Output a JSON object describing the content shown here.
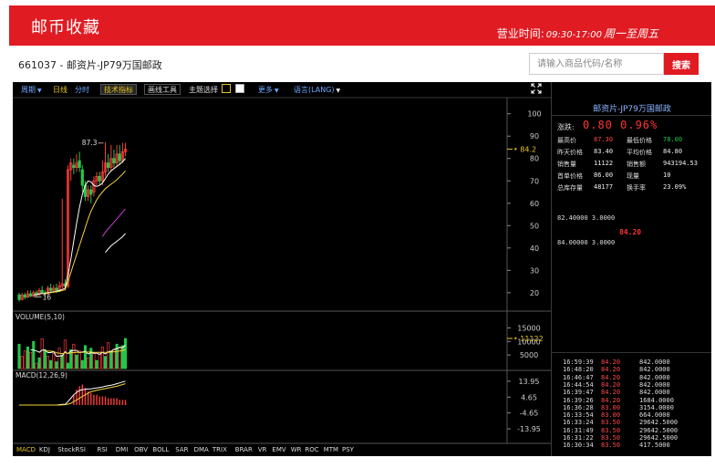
{
  "header": {
    "brand": "邮币收藏",
    "hours_label": "营业时间:",
    "hours_range": "09:30-17:00",
    "hours_days": "周一至周五"
  },
  "product": {
    "title": "661037 - 邮资片-JP79万国邮政"
  },
  "search": {
    "placeholder": "请输入商品代码/名称",
    "button": "搜索"
  },
  "toolbar": {
    "period": "周期",
    "daily": "日线",
    "minute": "分时",
    "tech": "技术指标",
    "draw": "画线工具",
    "theme": "主题选择",
    "more": "更多",
    "language": "语言(LANG)"
  },
  "colors": {
    "header_red": "#e01b22",
    "candle_up": "#ff3b3b",
    "candle_down": "#21c94b",
    "ma_white": "#ffffff",
    "ma_yellow": "#f2d33a",
    "ma_magenta": "#c93bd9",
    "price_label": "#e6c31f"
  },
  "icons": {
    "fullscreen": "fullscreen-icon",
    "dropdown": "chevron-down-icon",
    "checkbox": "theme-checkbox"
  },
  "chart_data": [
    {
      "type": "candlestick",
      "ytick_labels": [
        "100",
        "90",
        "80",
        "70",
        "60",
        "50",
        "40",
        "30",
        "20"
      ],
      "yticks": [
        100,
        90,
        80,
        70,
        60,
        50,
        40,
        30,
        20
      ],
      "ylim": [
        13,
        106
      ],
      "last_price": 84.2,
      "last_price_label": "84.2",
      "high_marker": 87.3,
      "high_label": "87.3",
      "low_marker": 16,
      "low_label": "16",
      "candles": [
        {
          "o": 19,
          "c": 17,
          "h": 20,
          "l": 16
        },
        {
          "o": 17,
          "c": 19,
          "h": 20,
          "l": 16.5
        },
        {
          "o": 19,
          "c": 18,
          "h": 20,
          "l": 17
        },
        {
          "o": 18,
          "c": 19.5,
          "h": 21,
          "l": 17.5
        },
        {
          "o": 19.5,
          "c": 18.5,
          "h": 21,
          "l": 18
        },
        {
          "o": 18.5,
          "c": 20,
          "h": 21,
          "l": 18
        },
        {
          "o": 20,
          "c": 19,
          "h": 21,
          "l": 18
        },
        {
          "o": 19,
          "c": 21,
          "h": 22,
          "l": 18.5
        },
        {
          "o": 21,
          "c": 20,
          "h": 23,
          "l": 19.5
        },
        {
          "o": 20,
          "c": 19.5,
          "h": 21,
          "l": 18
        },
        {
          "o": 19.5,
          "c": 22,
          "h": 23,
          "l": 19
        },
        {
          "o": 22,
          "c": 21,
          "h": 24,
          "l": 20
        },
        {
          "o": 21,
          "c": 22,
          "h": 23.5,
          "l": 20
        },
        {
          "o": 22,
          "c": 21,
          "h": 24,
          "l": 20
        },
        {
          "o": 21,
          "c": 23,
          "h": 25,
          "l": 20.5
        },
        {
          "o": 23,
          "c": 24,
          "h": 62,
          "l": 22
        },
        {
          "o": 24,
          "c": 23,
          "h": 26,
          "l": 22
        },
        {
          "o": 23,
          "c": 75,
          "h": 77,
          "l": 22
        },
        {
          "o": 75,
          "c": 78,
          "h": 80,
          "l": 70
        },
        {
          "o": 77,
          "c": 76,
          "h": 80,
          "l": 73
        },
        {
          "o": 76,
          "c": 78,
          "h": 82,
          "l": 74
        },
        {
          "o": 79,
          "c": 76,
          "h": 83,
          "l": 74
        },
        {
          "o": 75,
          "c": 68,
          "h": 77,
          "l": 65
        },
        {
          "o": 68,
          "c": 63,
          "h": 70,
          "l": 61
        },
        {
          "o": 63,
          "c": 66,
          "h": 68,
          "l": 61
        },
        {
          "o": 66,
          "c": 64,
          "h": 68,
          "l": 60
        },
        {
          "o": 65,
          "c": 70,
          "h": 72,
          "l": 63
        },
        {
          "o": 70,
          "c": 72,
          "h": 74,
          "l": 68
        },
        {
          "o": 72,
          "c": 70,
          "h": 74,
          "l": 68
        },
        {
          "o": 70,
          "c": 74,
          "h": 79,
          "l": 68
        },
        {
          "o": 74,
          "c": 78,
          "h": 87.3,
          "l": 72
        },
        {
          "o": 78,
          "c": 76,
          "h": 82,
          "l": 74
        },
        {
          "o": 76,
          "c": 80,
          "h": 86,
          "l": 74
        },
        {
          "o": 80,
          "c": 78,
          "h": 84,
          "l": 76
        },
        {
          "o": 78,
          "c": 82,
          "h": 86,
          "l": 76
        },
        {
          "o": 82,
          "c": 79,
          "h": 86,
          "l": 77
        },
        {
          "o": 79,
          "c": 83,
          "h": 87,
          "l": 78
        },
        {
          "o": 83,
          "c": 84.2,
          "h": 87,
          "l": 81
        }
      ],
      "ma_white": [
        null,
        null,
        null,
        null,
        null,
        19,
        19,
        19.5,
        19.6,
        19.7,
        20,
        20.2,
        20.4,
        20.6,
        21,
        21.5,
        22,
        28,
        35,
        43,
        51,
        58,
        64,
        68,
        70,
        69.5,
        68,
        67.5,
        68,
        69,
        71,
        73,
        74.5,
        75.5,
        76.5,
        77.5,
        78.5,
        80
      ],
      "ma_yellow": [
        null,
        null,
        null,
        null,
        null,
        null,
        null,
        null,
        null,
        19.5,
        19.8,
        20,
        20.2,
        20.4,
        20.6,
        21,
        21.3,
        25,
        29,
        33,
        37,
        41,
        45,
        49,
        53,
        56.5,
        59,
        61.5,
        63.5,
        65,
        66.5,
        67.5,
        68.5,
        69.5,
        70.5,
        71.8,
        73,
        74.5
      ],
      "ma_magenta": [
        null,
        null,
        null,
        null,
        null,
        null,
        null,
        null,
        null,
        null,
        null,
        null,
        null,
        null,
        null,
        null,
        null,
        null,
        null,
        null,
        null,
        null,
        null,
        null,
        null,
        null,
        null,
        null,
        null,
        45,
        47,
        48.5,
        50,
        51.5,
        53,
        54.5,
        56,
        57.5
      ],
      "ma_white2": [
        null,
        null,
        null,
        null,
        null,
        null,
        null,
        null,
        null,
        null,
        null,
        null,
        null,
        null,
        null,
        null,
        null,
        null,
        null,
        null,
        null,
        null,
        null,
        null,
        null,
        null,
        null,
        null,
        null,
        null,
        38,
        39.5,
        41,
        42,
        43,
        44,
        45,
        46.5
      ]
    },
    {
      "type": "bar",
      "title": "VOLUME(5,10)",
      "ytick_labels": [
        "15000",
        "10000",
        "5000"
      ],
      "yticks": [
        15000,
        10000,
        5000
      ],
      "ylim": [
        0,
        17500
      ],
      "last_volume": 11122,
      "last_volume_label": "11122",
      "values": [
        9000,
        4500,
        6500,
        8000,
        6000,
        10000,
        2000,
        4000,
        11000,
        7000,
        4500,
        3000,
        5500,
        2500,
        7500,
        5000,
        10500,
        2000,
        7000,
        9000,
        5000,
        6500,
        3000,
        8500,
        4000,
        7500,
        5500,
        3000,
        6000,
        8000,
        4500,
        9500,
        6500,
        7000,
        9000,
        7500,
        8500,
        11122
      ],
      "up": [
        0,
        1,
        1,
        0,
        1,
        0,
        1,
        0,
        1,
        0,
        1,
        0,
        1,
        0,
        1,
        0,
        1,
        0,
        0,
        1,
        0,
        1,
        0,
        0,
        1,
        0,
        1,
        0,
        1,
        1,
        0,
        1,
        0,
        1,
        0,
        1,
        0,
        0
      ],
      "ma5": [
        null,
        null,
        null,
        null,
        7000,
        6800,
        6500,
        6000,
        6800,
        6800,
        5900,
        5900,
        6200,
        4500,
        4600,
        4700,
        6200,
        5500,
        6500,
        6700,
        6700,
        5900,
        6100,
        6400,
        5400,
        5900,
        5700,
        5700,
        5200,
        6000,
        5400,
        6200,
        6300,
        7100,
        7300,
        7900,
        7700,
        8600
      ],
      "ma10": [
        null,
        null,
        null,
        null,
        null,
        null,
        null,
        null,
        null,
        6500,
        6500,
        6400,
        6300,
        5800,
        5700,
        5500,
        5900,
        5600,
        5800,
        5900,
        6000,
        6000,
        6000,
        6100,
        6100,
        6100,
        6000,
        6000,
        6000,
        6000,
        6000,
        6000,
        6100,
        6200,
        6300,
        6500,
        6700,
        7000
      ]
    },
    {
      "type": "bar",
      "title": "MACD(12,26,9)",
      "ytick_labels": [
        "13.95",
        "4.65",
        "-4.65",
        "-13.95"
      ],
      "yticks": [
        13.95,
        4.65,
        -4.65,
        -13.95
      ],
      "ylim": [
        -15,
        15.5
      ],
      "values": [
        0,
        0,
        0,
        0,
        0,
        0,
        0,
        0,
        0,
        0,
        0,
        0,
        0,
        0,
        0,
        0,
        0,
        0,
        0,
        6,
        9,
        11,
        12,
        10,
        8,
        7,
        6,
        6,
        5,
        5,
        5,
        4,
        4,
        4,
        4,
        3,
        3,
        3
      ],
      "dif": [
        0,
        0,
        0,
        0,
        0,
        0,
        0,
        0,
        0,
        0,
        0,
        0,
        0,
        0,
        0.2,
        0.4,
        0.4,
        2,
        4,
        6,
        7.5,
        8.5,
        9,
        9.2,
        9.4,
        9.5,
        9.8,
        10,
        10.3,
        10.6,
        11,
        11.3,
        11.6,
        12,
        12.5,
        13,
        13.5,
        14
      ],
      "dea": [
        0,
        0,
        0,
        0,
        0,
        0,
        0,
        0,
        0,
        0,
        0,
        0,
        0,
        0,
        0,
        0.1,
        0.2,
        0.5,
        1,
        2,
        3,
        4,
        5,
        6,
        7,
        7.8,
        8.2,
        8.6,
        9,
        9.3,
        9.6,
        10,
        10.3,
        10.7,
        11,
        11.5,
        12,
        12.5
      ]
    }
  ],
  "panel": {
    "title": "邮资片-JP79万国邮政",
    "change_label": "涨跌:",
    "change_value": "0.80 0.96%",
    "stats": [
      {
        "k": "最高价",
        "v": "87.30",
        "c": "red"
      },
      {
        "k": "最低价格",
        "v": "78.00",
        "c": "green"
      },
      {
        "k": "昨天价格",
        "v": "83.40",
        "c": "white"
      },
      {
        "k": "平均价格",
        "v": "84.80",
        "c": "white"
      },
      {
        "k": "销售量",
        "v": "11122",
        "c": "white"
      },
      {
        "k": "销售额",
        "v": "943194.53",
        "c": "white"
      },
      {
        "k": "首单价格",
        "v": "86.00",
        "c": "white"
      },
      {
        "k": "现量",
        "v": "10",
        "c": "white"
      },
      {
        "k": "总库存量",
        "v": "48177",
        "c": "white"
      },
      {
        "k": "换手率",
        "v": "23.09%",
        "c": "white"
      }
    ],
    "book_ask": "82.40000     3.0000",
    "last_price": "84.20",
    "book_bid": "84.00000     3.0000",
    "trades": [
      {
        "t": "16:59:39",
        "p": "84.20",
        "q": "842.0000"
      },
      {
        "t": "16:48:20",
        "p": "84.20",
        "q": "842.0000"
      },
      {
        "t": "16:46:47",
        "p": "84.20",
        "q": "842.0000"
      },
      {
        "t": "16:44:54",
        "p": "84.20",
        "q": "842.0000"
      },
      {
        "t": "16:39:47",
        "p": "84.20",
        "q": "842.0000"
      },
      {
        "t": "16:39:26",
        "p": "84.20",
        "q": "1684.0000"
      },
      {
        "t": "16:36:28",
        "p": "83.00",
        "q": "3154.0000"
      },
      {
        "t": "16:33:54",
        "p": "83.00",
        "q": "664.0000"
      },
      {
        "t": "16:33:24",
        "p": "83.50",
        "q": "29642.5000"
      },
      {
        "t": "16:31:49",
        "p": "83.50",
        "q": "29642.5000"
      },
      {
        "t": "16:31:22",
        "p": "83.50",
        "q": "29642.5000"
      },
      {
        "t": "16:30:34",
        "p": "83.50",
        "q": "417.5000"
      }
    ]
  },
  "bottom_tabs": [
    "MACD",
    "KDJ",
    "StockRSI",
    "RSI",
    "DMI",
    "OBV",
    "BOLL",
    "SAR",
    "DMA",
    "TRIX",
    "BRAR",
    "VR",
    "EMV",
    "WR",
    "ROC",
    "MTM",
    "PSY"
  ]
}
